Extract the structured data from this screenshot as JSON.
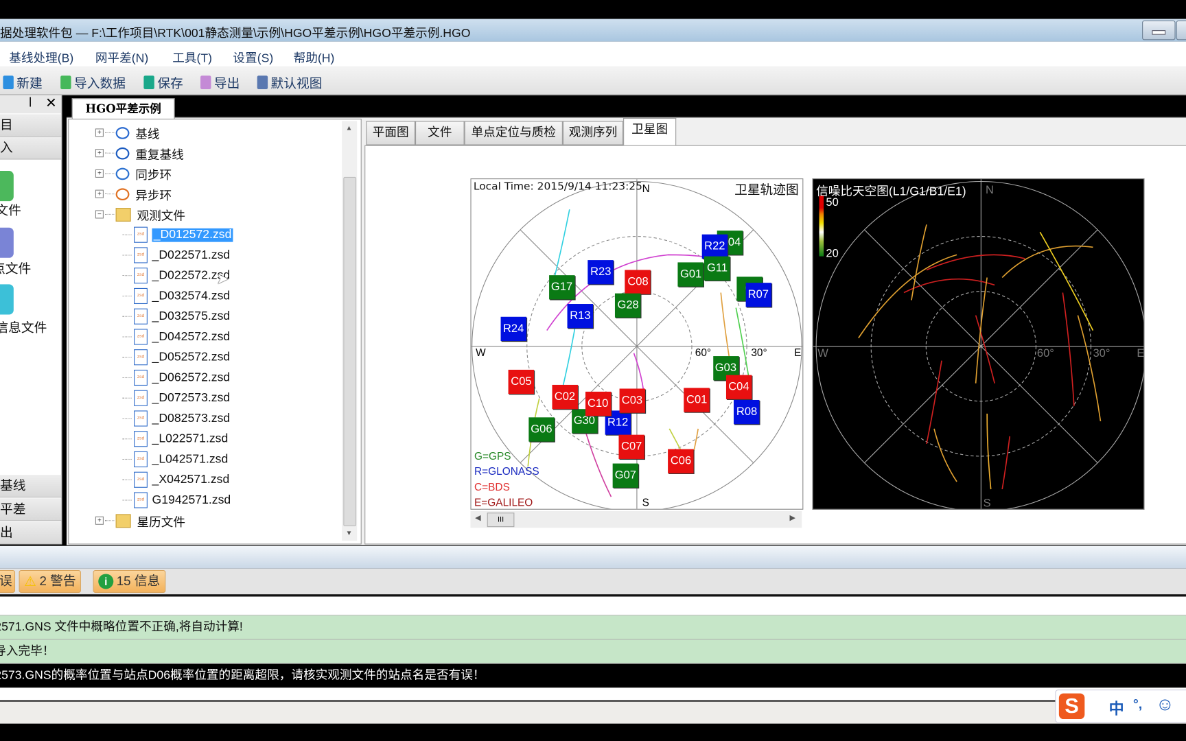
{
  "window": {
    "title": "据处理软件包 — F:\\工作项目\\RTK\\001静态测量\\示例\\HGO平差示例\\HGO平差示例.HGO"
  },
  "menu": [
    "基线处理(B)",
    "网平差(N)",
    "工具(T)",
    "设置(S)",
    "帮助(H)"
  ],
  "toolbar": [
    {
      "label": "新建",
      "icon": "new-file-icon",
      "color": "#2d8fe0"
    },
    {
      "label": "导入数据",
      "icon": "import-icon",
      "color": "#46b85a"
    },
    {
      "label": "保存",
      "icon": "save-icon",
      "color": "#1aa88a"
    },
    {
      "label": "导出",
      "icon": "export-icon",
      "color": "#c48ad6"
    },
    {
      "label": "默认视图",
      "icon": "default-view-icon",
      "color": "#5a78b0"
    }
  ],
  "left_panel": {
    "rows_top": [
      "目",
      "入"
    ],
    "items": [
      {
        "label": "文件",
        "color": "#4cb85c"
      },
      {
        "label": "点文件",
        "color": "#7a84d6"
      },
      {
        "label": "信息文件",
        "color": "#3cc0d8"
      }
    ],
    "rows_bottom": [
      "基线",
      "平差",
      "出"
    ]
  },
  "doc_tab": "HGO平差示例",
  "tree": {
    "nodes": [
      {
        "label": "基线",
        "icon": "baseline-icon"
      },
      {
        "label": "重复基线",
        "icon": "repeat-baseline-icon"
      },
      {
        "label": "同步环",
        "icon": "sync-loop-icon"
      },
      {
        "label": "异步环",
        "icon": "async-loop-icon"
      },
      {
        "label": "观测文件",
        "icon": "folder-icon",
        "expanded": true
      }
    ],
    "files": [
      "_D012572.zsd",
      "_D022571.zsd",
      "_D022572.zsd",
      "_D032574.zsd",
      "_D032575.zsd",
      "_D042572.zsd",
      "_D052572.zsd",
      "_D062572.zsd",
      "_D072573.zsd",
      "_D082573.zsd",
      "_L022571.zsd",
      "_L042571.zsd",
      "_X042571.zsd",
      "G1942571.zsd"
    ],
    "selected_file": "_D012572.zsd",
    "file_icon_text": "zsd",
    "last_node": {
      "label": "星历文件",
      "icon": "folder-icon"
    }
  },
  "tabs": [
    {
      "label": "平面图"
    },
    {
      "label": "文件"
    },
    {
      "label": "单点定位与质检"
    },
    {
      "label": "观测序列"
    },
    {
      "label": "卫星图",
      "active": true
    }
  ],
  "sky_track": {
    "title": "卫星轨迹图",
    "time": "Local Time: 2015/9/14 11:23:25",
    "directions": {
      "n": "N",
      "s": "S",
      "e": "E",
      "w": "W"
    },
    "rings": {
      "r60": "60°",
      "r30": "30°"
    },
    "colors": {
      "G": "#0a7a14",
      "R": "#0010e0",
      "C": "#e81010",
      "E": "#a01818"
    },
    "legend": [
      {
        "text": "G=GPS",
        "color": "#2a8a2a"
      },
      {
        "text": "R=GLONASS",
        "color": "#1a2ac0"
      },
      {
        "text": "C=BDS",
        "color": "#e03030"
      },
      {
        "text": "E=GALILEO",
        "color": "#a01818"
      }
    ],
    "satellites": [
      {
        "id": "G04",
        "sys": "G",
        "az": 42,
        "el": 14
      },
      {
        "id": "R22",
        "sys": "R",
        "az": 38,
        "el": 21
      },
      {
        "id": "G11",
        "sys": "G",
        "az": 46,
        "el": 29
      },
      {
        "id": "G01",
        "sys": "G",
        "az": 37,
        "el": 41
      },
      {
        "id": "G",
        "sys": "G",
        "az": 63,
        "el": 21
      },
      {
        "id": "R07",
        "sys": "R",
        "az": 67,
        "el": 18
      },
      {
        "id": "G17",
        "sys": "G",
        "az": 308,
        "el": 38
      },
      {
        "id": "R23",
        "sys": "R",
        "az": 334,
        "el": 45
      },
      {
        "id": "C08",
        "sys": "C",
        "az": 1,
        "el": 55
      },
      {
        "id": "G28",
        "sys": "G",
        "az": 348,
        "el": 67
      },
      {
        "id": "R13",
        "sys": "R",
        "az": 298,
        "el": 55
      },
      {
        "id": "R24",
        "sys": "R",
        "az": 278,
        "el": 22
      },
      {
        "id": "G03",
        "sys": "G",
        "az": 104,
        "el": 40
      },
      {
        "id": "C04",
        "sys": "C",
        "az": 112,
        "el": 30
      },
      {
        "id": "R08",
        "sys": "R",
        "az": 121,
        "el": 20
      },
      {
        "id": "C01",
        "sys": "C",
        "az": 132,
        "el": 46
      },
      {
        "id": "C05",
        "sys": "C",
        "az": 253,
        "el": 24
      },
      {
        "id": "G06",
        "sys": "G",
        "az": 229,
        "el": 21
      },
      {
        "id": "G30",
        "sys": "G",
        "az": 215,
        "el": 40
      },
      {
        "id": "R12",
        "sys": "R",
        "az": 194,
        "el": 47
      },
      {
        "id": "C02",
        "sys": "C",
        "az": 235,
        "el": 42
      },
      {
        "id": "C10",
        "sys": "C",
        "az": 214,
        "el": 52
      },
      {
        "id": "C03",
        "sys": "C",
        "az": 185,
        "el": 60
      },
      {
        "id": "G07",
        "sys": "G",
        "az": 185,
        "el": 19
      },
      {
        "id": "C07",
        "sys": "C",
        "az": 183,
        "el": 35
      },
      {
        "id": "C06",
        "sys": "C",
        "az": 159,
        "el": 23
      }
    ]
  },
  "sky_snr": {
    "title": "信噪比天空图(L1/G1/B1/E1)",
    "scale_max": "50",
    "scale_min": "20",
    "directions": {
      "n": "N",
      "s": "S",
      "e": "E",
      "w": "W"
    },
    "rings": {
      "r60": "60°",
      "r30": "30°"
    }
  },
  "messages": {
    "error_btn": "误",
    "warning_btn": "2 警告",
    "info_btn": "15 信息",
    "rows": [
      {
        "text": "2571.GNS  文件中概略位置不正确,将自动计算!",
        "bg": "#c6e6c8",
        "fg": "#111"
      },
      {
        "text": "导入完毕！",
        "bg": "#c6e6c8",
        "fg": "#111"
      },
      {
        "text": "2573.GNS的概率位置与站点D06概率位置的距离超限，请核实观测文件的站点名是否有误！",
        "bg": "#000000",
        "fg": "#ffffff"
      }
    ]
  },
  "ime": {
    "lang": "中",
    "punct": "°,"
  }
}
